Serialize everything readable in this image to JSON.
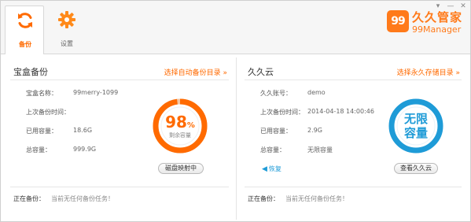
{
  "window": {
    "controls": [
      "▾",
      "—",
      "✕"
    ]
  },
  "tabs": [
    {
      "label": "备份",
      "icon": "sync-icon",
      "active": true
    },
    {
      "label": "设置",
      "icon": "gear-icon",
      "active": false
    }
  ],
  "logo": {
    "badge": "99",
    "name_cn": "久久管家",
    "name_en": "99Manager"
  },
  "colors": {
    "accent": "#ff6a00",
    "blue": "#1e9bd7",
    "ring_track": "#f3c7a6"
  },
  "left_panel": {
    "title": "宝盒备份",
    "link": "选择自动备份目录 »",
    "fields": [
      {
        "key": "宝盒名称：",
        "value": "99merry-1099"
      },
      {
        "key": "上次备份时间：",
        "value": ""
      },
      {
        "key": "已用容量：",
        "value": "18.6G"
      },
      {
        "key": "总容量：",
        "value": "999.9G"
      }
    ],
    "gauge": {
      "percent": 98,
      "percent_text": "98",
      "unit": "%",
      "label": "剩余容量"
    },
    "button": "磁盘映射中",
    "status_key": "正在备份：",
    "status_value": "当前无任何备份任务！"
  },
  "right_panel": {
    "title": "久久云",
    "link": "选择永久存储目录 »",
    "fields": [
      {
        "key": "久久账号：",
        "value": "demo"
      },
      {
        "key": "上次备份时间：",
        "value": "2014-04-18 14:00:46"
      },
      {
        "key": "已用容量：",
        "value": "2.9G"
      },
      {
        "key": "总容量：",
        "value": "无限容量"
      }
    ],
    "gauge": {
      "line1": "无限",
      "line2": "容量"
    },
    "restore": "恢复",
    "button": "查看久久云",
    "status_key": "正在备份：",
    "status_value": "当前无任何备份任务！"
  }
}
